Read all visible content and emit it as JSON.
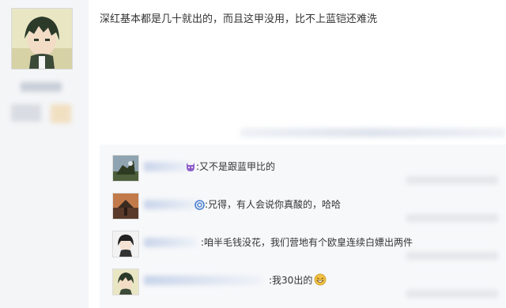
{
  "post": {
    "text": "深红基本都是几十就出的，而且这甲没用，比不上蓝铠还难洗"
  },
  "replies": [
    {
      "colon": ":",
      "content": "又不是跟蓝甲比的",
      "emoji": "devil-face-emoji"
    },
    {
      "colon": ":",
      "content": "兄得，有人会说你真酸的，哈哈",
      "emoji": "swirl-emoji"
    },
    {
      "colon": ":",
      "content": "咱半毛钱没花，我们营地有个欧皇连续白嫖出两件",
      "emoji": ""
    },
    {
      "colon": ":",
      "content": "我30出的",
      "emoji": "grin-face-emoji"
    }
  ],
  "colors": {
    "left_background": "#f4f5f7",
    "reply_background": "#f7f8fa",
    "blurred_name": "#c8d4ea"
  }
}
